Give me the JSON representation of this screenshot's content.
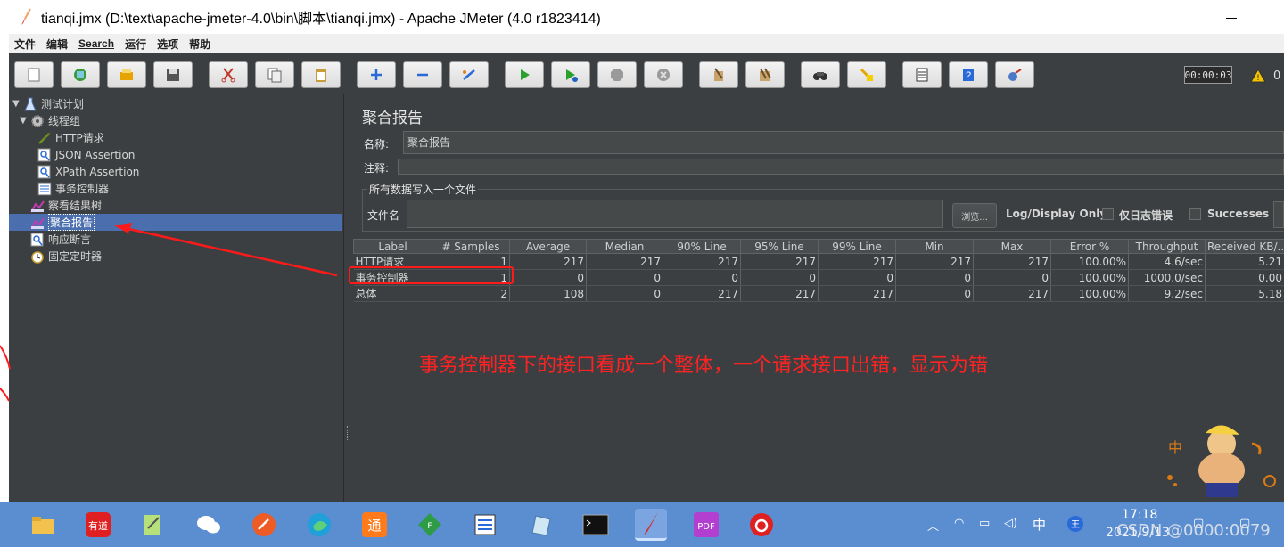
{
  "window": {
    "title": "tianqi.jmx (D:\\text\\apache-jmeter-4.0\\bin\\脚本\\tianqi.jmx) - Apache JMeter (4.0 r1823414)"
  },
  "menu": [
    "文件",
    "编辑",
    "Search",
    "运行",
    "选项",
    "帮助"
  ],
  "toolbar": {
    "buttons": [
      "new-icon",
      "templates-icon",
      "open-icon",
      "save-icon",
      "cut-icon",
      "copy-icon",
      "paste-icon",
      "expand-icon",
      "collapse-icon",
      "toggle-icon",
      "start-icon",
      "start-no-pause-icon",
      "stop-icon",
      "shutdown-icon",
      "clear-icon",
      "clear-all-icon",
      "search-icon",
      "reset-search-icon",
      "function-helper-icon",
      "help-icon",
      "remote-icon"
    ],
    "timer": "00:00:03",
    "warning_count": "0"
  },
  "tree": {
    "items": [
      {
        "label": "测试计划",
        "icon": "test-plan-icon"
      },
      {
        "label": "线程组",
        "icon": "thread-group-icon"
      },
      {
        "label": "HTTP请求",
        "icon": "http-request-icon"
      },
      {
        "label": "JSON Assertion",
        "icon": "assertion-icon"
      },
      {
        "label": "XPath Assertion",
        "icon": "assertion-icon"
      },
      {
        "label": "事务控制器",
        "icon": "transaction-controller-icon"
      },
      {
        "label": "察看结果树",
        "icon": "listener-icon"
      },
      {
        "label": "聚合报告",
        "icon": "listener-icon"
      },
      {
        "label": "响应断言",
        "icon": "assertion-icon"
      },
      {
        "label": "固定定时器",
        "icon": "timer-icon"
      }
    ],
    "selected": "聚合报告"
  },
  "report": {
    "title": "聚合报告",
    "name_label": "名称:",
    "name_value": "聚合报告",
    "comment_label": "注释:",
    "comment_value": "",
    "file_group_label": "所有数据写入一个文件",
    "filename_label": "文件名",
    "filename_value": "",
    "browse_label": "浏览...",
    "log_display_label": "Log/Display Only:",
    "errors_only_label": "仅日志错误",
    "successes_label": "Successes"
  },
  "table": {
    "columns": [
      "Label",
      "# Samples",
      "Average",
      "Median",
      "90% Line",
      "95% Line",
      "99% Line",
      "Min",
      "Max",
      "Error %",
      "Throughput",
      "Received KB/..."
    ],
    "rows": [
      [
        "HTTP请求",
        "1",
        "217",
        "217",
        "217",
        "217",
        "217",
        "217",
        "217",
        "100.00%",
        "4.6/sec",
        "5.21"
      ],
      [
        "事务控制器",
        "1",
        "0",
        "0",
        "0",
        "0",
        "0",
        "0",
        "0",
        "100.00%",
        "1000.0/sec",
        "0.00"
      ],
      [
        "总体",
        "2",
        "108",
        "0",
        "217",
        "217",
        "217",
        "0",
        "217",
        "100.00%",
        "9.2/sec",
        "5.18"
      ]
    ]
  },
  "annotation": {
    "text": "事务控制器下的接口看成一个整体，一个请求接口出错，显示为错",
    "color": "#ff2222"
  },
  "taskbar": {
    "apps": [
      "file-explorer-icon",
      "youdao-icon",
      "notepad-icon",
      "wechat-icon",
      "postman-icon",
      "edge-icon",
      "tongxin-icon",
      "feather-icon",
      "tool-icon",
      "notes-icon",
      "terminal-icon",
      "jmeter-icon",
      "pdf-icon",
      "netease-music-icon"
    ],
    "youdao_label": "有道",
    "tongxin_label": "通",
    "pdf_label": "PDF",
    "ime": "中",
    "time": "17:18",
    "date": "2021/9/13"
  },
  "watermark": "CSDN @0000:0079"
}
